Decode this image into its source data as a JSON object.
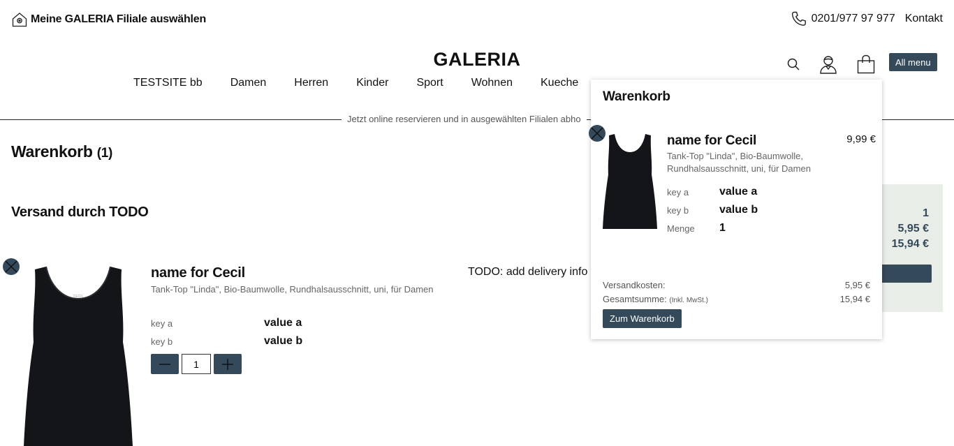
{
  "header": {
    "store_select_label": "Meine GALERIA Filiale auswählen",
    "phone": "0201/977 97 977",
    "contact_label": "Kontakt",
    "logo": "GALERIA",
    "all_menu_label": "All menu"
  },
  "nav": {
    "items": [
      {
        "label": "TESTSITE bb"
      },
      {
        "label": "Damen"
      },
      {
        "label": "Herren"
      },
      {
        "label": "Kinder"
      },
      {
        "label": "Sport"
      },
      {
        "label": "Wohnen"
      },
      {
        "label": "Kueche"
      }
    ]
  },
  "promo_text": "Jetzt online reservieren und in ausgewählten Filialen abho",
  "cart_page": {
    "title": "Warenkorb",
    "count": "(1)",
    "section_title": "Versand durch TODO",
    "item": {
      "name": "name for Cecil",
      "description": "Tank-Top \"Linda\", Bio-Baumwolle, Rundhalsausschnitt, uni, für Damen",
      "attributes": [
        {
          "key": "key a",
          "value": "value a"
        },
        {
          "key": "key b",
          "value": "value b"
        }
      ],
      "quantity": "1"
    },
    "delivery_info": "TODO: add delivery info h"
  },
  "summary": {
    "count": "1",
    "shipping": "5,95 €",
    "total": "15,94 €"
  },
  "minicart": {
    "title": "Warenkorb",
    "item": {
      "name": "name for Cecil",
      "price": "9,99 €",
      "description": "Tank-Top \"Linda\", Bio-Baumwolle, Rundhalsausschnitt, uni, für Damen",
      "attributes": [
        {
          "key": "key a",
          "value": "value a"
        },
        {
          "key": "key b",
          "value": "value b"
        },
        {
          "key": "Menge",
          "value": "1"
        }
      ]
    },
    "shipping_label": "Versandkosten:",
    "shipping_value": "5,95 €",
    "total_label": "Gesamtsumme:",
    "total_note": "(Inkl. MwSt.)",
    "total_value": "15,94 €",
    "button_label": "Zum Warenkorb"
  },
  "colors": {
    "accent": "#34495a",
    "summary_bg": "#e9ede8"
  }
}
